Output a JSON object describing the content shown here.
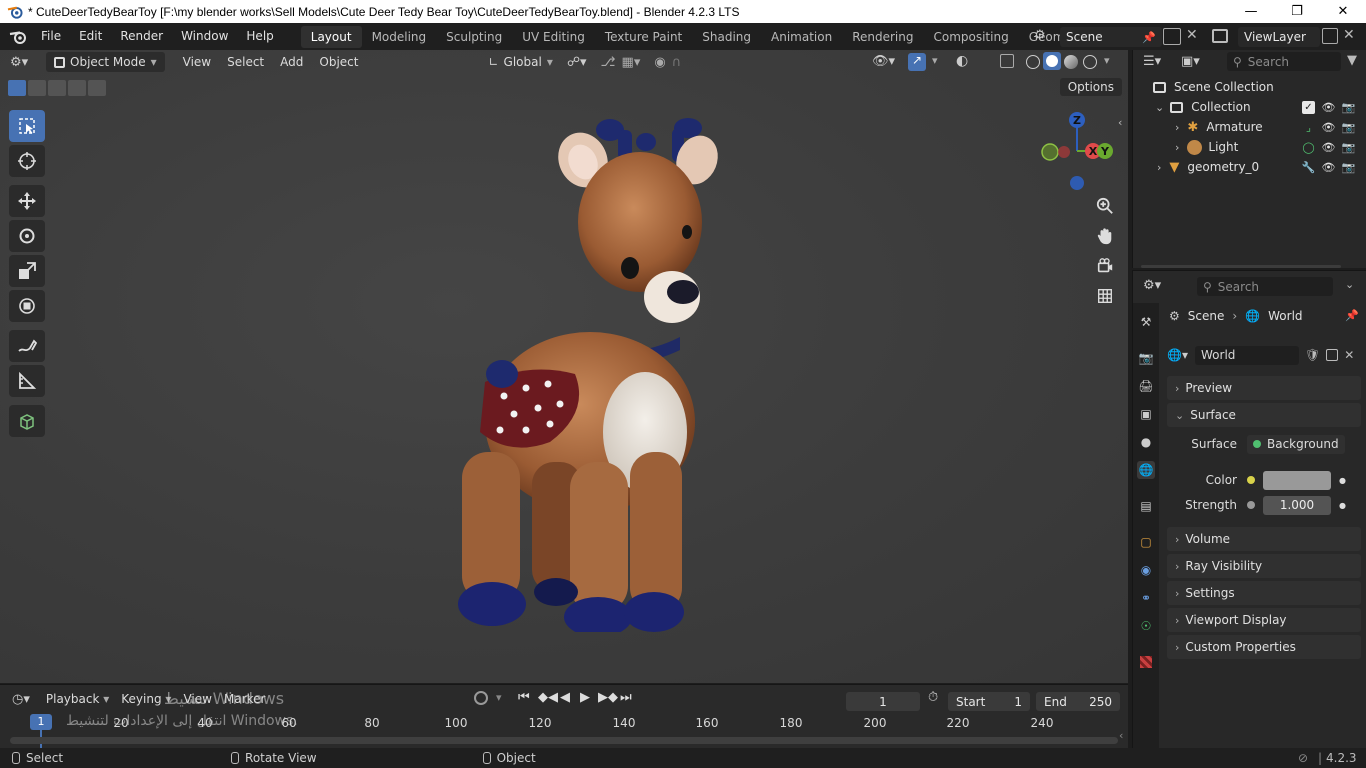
{
  "window": {
    "title": "* CuteDeerTedyBearToy [F:\\my blender works\\Sell Models\\Cute Deer Tedy Bear Toy\\CuteDeerTedyBearToy.blend] - Blender 4.2.3 LTS",
    "min_glyph": "—",
    "max_glyph": "❐",
    "close_glyph": "✕"
  },
  "menu": {
    "file": "File",
    "edit": "Edit",
    "render": "Render",
    "window": "Window",
    "help": "Help"
  },
  "workspaces": [
    "Layout",
    "Modeling",
    "Sculpting",
    "UV Editing",
    "Texture Paint",
    "Shading",
    "Animation",
    "Rendering",
    "Compositing",
    "Geometry Nodes"
  ],
  "scene_name": "Scene",
  "view_layer": "ViewLayer",
  "viewport": {
    "mode": "Object Mode",
    "view": "View",
    "select": "Select",
    "add": "Add",
    "object": "Object",
    "orientation": "Global",
    "options": "Options",
    "gizmo_z": "Z",
    "gizmo_y": "Y"
  },
  "timeline": {
    "playback": "Playback",
    "keying": "Keying",
    "view": "View",
    "marker": "Marker",
    "current_frame": "1",
    "start_label": "Start",
    "start_value": "1",
    "end_label": "End",
    "end_value": "250",
    "playhead": "1",
    "ruler": [
      "20",
      "40",
      "60",
      "80",
      "100",
      "120",
      "140",
      "160",
      "180",
      "200",
      "220",
      "240"
    ],
    "watermark_line1": "تنشيط Windows",
    "watermark_line2": "انتقل إلى الإعدادات لتنشيط Windows."
  },
  "statusbar": {
    "select": "Select",
    "rotate": "Rotate View",
    "object": "Object",
    "version": "4.2.3"
  },
  "outliner": {
    "search_placeholder": "Search",
    "scene_collection": "Scene Collection",
    "collection": "Collection",
    "armature": "Armature",
    "light": "Light",
    "geometry": "geometry_0"
  },
  "properties": {
    "search_placeholder": "Search",
    "breadcrumb_scene": "Scene",
    "breadcrumb_world": "World",
    "world_name": "World",
    "panels": {
      "preview": "Preview",
      "surface": "Surface",
      "volume": "Volume",
      "ray_visibility": "Ray Visibility",
      "settings": "Settings",
      "viewport_display": "Viewport Display",
      "custom_properties": "Custom Properties"
    },
    "surface_label": "Surface",
    "surface_value": "Background",
    "color_label": "Color",
    "strength_label": "Strength",
    "strength_value": "1.000"
  },
  "colors": {
    "accent": "#4772b3",
    "world_color": "#999999"
  }
}
